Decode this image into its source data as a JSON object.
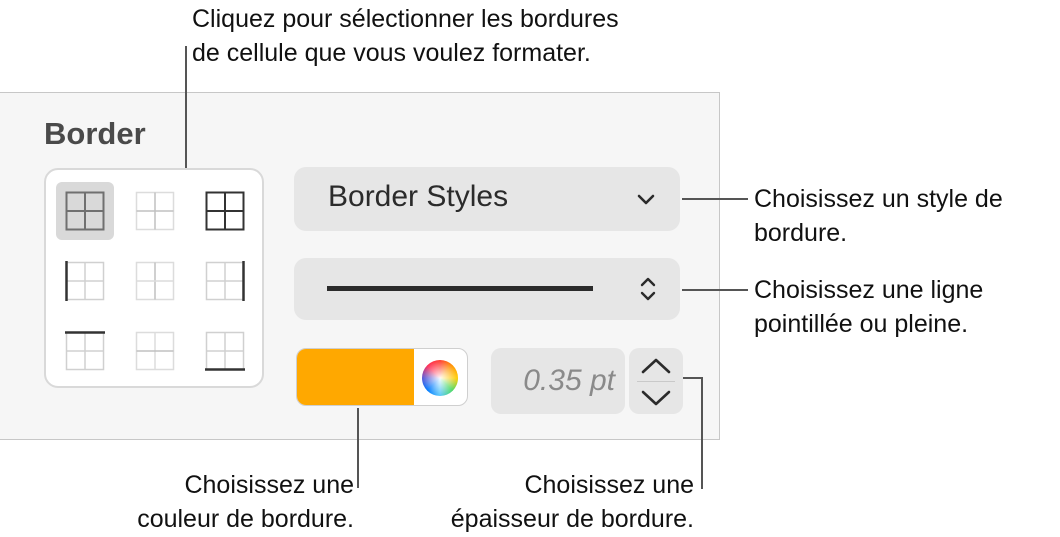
{
  "panel": {
    "title": "Border",
    "border_styles_label": "Border Styles",
    "thickness_value": "0.35 pt",
    "color_swatch": "#FFA800"
  },
  "callouts": {
    "select_borders": [
      "Cliquez pour sélectionner les bordures",
      "de cellule que vous voulez formater."
    ],
    "choose_style": [
      "Choisissez un style de",
      "bordure."
    ],
    "choose_line": [
      "Choisissez une ligne",
      "pointillée ou pleine."
    ],
    "choose_color": [
      "Choisissez une",
      "couleur de bordure."
    ],
    "choose_thickness": [
      "Choisissez une",
      "épaisseur de bordure."
    ]
  },
  "border_buttons": [
    {
      "name": "all-borders",
      "selected": true
    },
    {
      "name": "inside-borders",
      "selected": false
    },
    {
      "name": "outside-borders",
      "selected": false
    },
    {
      "name": "left-border",
      "selected": false
    },
    {
      "name": "inside-vertical-border",
      "selected": false
    },
    {
      "name": "right-border",
      "selected": false
    },
    {
      "name": "top-border",
      "selected": false
    },
    {
      "name": "inside-horizontal-border",
      "selected": false
    },
    {
      "name": "bottom-border",
      "selected": false
    }
  ],
  "icons": {
    "styles_chevron": "chevron-down-icon",
    "line_stepper": "up-down-chevron-icon",
    "color_wheel": "color-wheel-icon",
    "thickness_up": "chevron-up-icon",
    "thickness_down": "chevron-down-icon"
  }
}
